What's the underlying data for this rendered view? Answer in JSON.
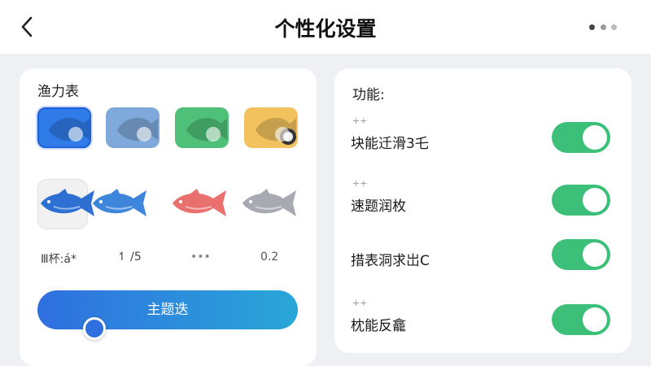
{
  "header": {
    "title": "个性化设置",
    "back_icon": "chevron-left-icon",
    "more_icon": "more-dots-icon"
  },
  "left_panel": {
    "title": "渔力表",
    "swatches": [
      {
        "name": "blue",
        "color": "#2f7be8",
        "selected": true
      },
      {
        "name": "light-blue",
        "color": "#7ea9da",
        "selected": false
      },
      {
        "name": "green",
        "color": "#4fc078",
        "selected": false
      },
      {
        "name": "yellow",
        "color": "#f1c25e",
        "selected": false
      }
    ],
    "fish": [
      {
        "name": "fish-blue",
        "color": "#2d6fd3",
        "selected": true
      },
      {
        "name": "fish-light-blue",
        "color": "#3d86dc",
        "selected": false
      },
      {
        "name": "fish-red",
        "color": "#e9706f",
        "selected": false
      },
      {
        "name": "fish-gray",
        "color": "#a7aab0",
        "selected": false
      }
    ],
    "fish_labels": [
      "Ⅲ杯:á*",
      "↿ /5",
      "•••",
      "0.2"
    ],
    "theme_button_label": "主题迭",
    "slider_value": 0.22
  },
  "right_panel": {
    "title": "功能:",
    "items": [
      {
        "hash": "++",
        "label": "块能迁滑3乇",
        "on": true
      },
      {
        "hash": "++",
        "label": "速题润枚",
        "on": true
      },
      {
        "hash": "",
        "label": "措表洞求岀C",
        "on": true
      },
      {
        "hash": "++",
        "label": "枕能反龕",
        "on": true
      }
    ]
  },
  "colors": {
    "accent": "#2f6fe0",
    "toggle_on": "#3cbf78"
  }
}
